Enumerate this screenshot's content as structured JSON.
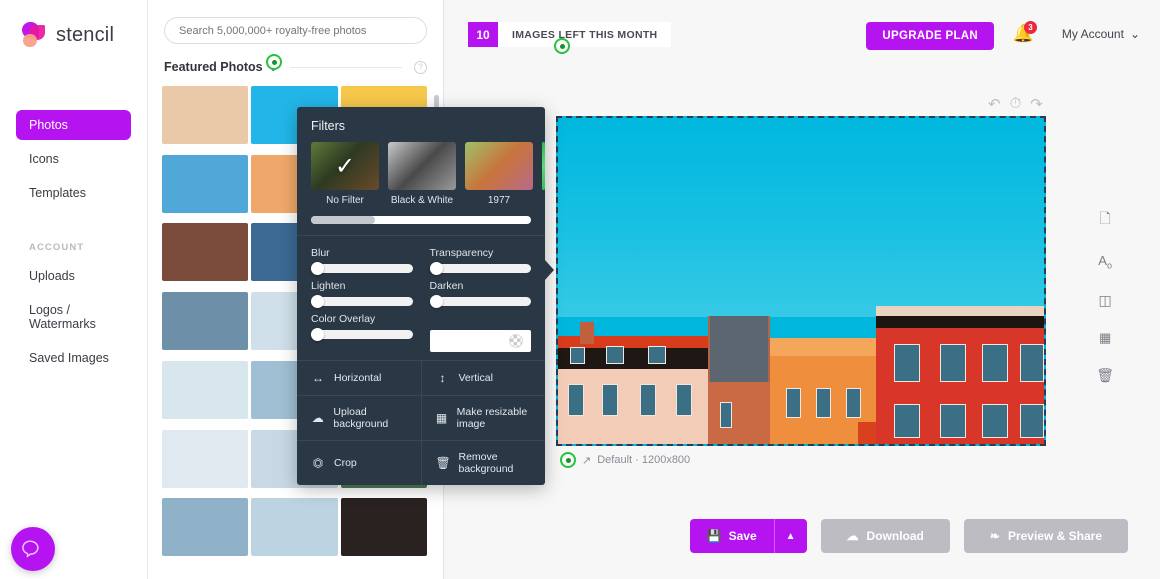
{
  "brand": {
    "name": "stencil",
    "logo_icon": "stencil-logo-icon"
  },
  "sidebar": {
    "items": [
      {
        "label": "Photos",
        "active": true
      },
      {
        "label": "Icons",
        "active": false
      },
      {
        "label": "Templates",
        "active": false
      }
    ],
    "section_label": "ACCOUNT",
    "account_items": [
      {
        "label": "Uploads"
      },
      {
        "label": "Logos / Watermarks"
      },
      {
        "label": "Saved Images"
      }
    ]
  },
  "search": {
    "placeholder": "Search 5,000,000+ royalty-free photos",
    "value": ""
  },
  "photo_panel": {
    "featured_title": "Featured Photos",
    "chevron_icon": "chevron-down-icon",
    "help_icon": "question-mark-icon",
    "help_label": "?",
    "thumbs": [
      "#e9c9a8",
      "#22b6e8",
      "#f6c84a",
      "#4fa8d8",
      "#f0a86a",
      "#2f6f9a",
      "#7a4a3a",
      "#3c6a94",
      "#c9d6e2",
      "#6d8fa8",
      "#cfe0ea",
      "#b4cfe0",
      "#d8e6ee",
      "#9fc0d4",
      "#e8eef2",
      "#dfe9ef",
      "#c8d8e4",
      "#4f7a56",
      "#8fb2c8",
      "#bcd4e2",
      "#2a2220"
    ]
  },
  "header": {
    "quota_number": "10",
    "quota_text": "IMAGES LEFT THIS MONTH",
    "upgrade_label": "UPGRADE PLAN",
    "bell_icon": "bell-icon",
    "bell_badge": "3",
    "account_label": "My Account",
    "account_caret_icon": "chevron-down-icon"
  },
  "canvas": {
    "undo_icon": "undo-icon",
    "history_icon": "history-clock-icon",
    "redo_icon": "redo-icon",
    "label": "Default · 1200x800",
    "resize_icon": "resize-arrow-icon",
    "tools": [
      {
        "icon": "page-icon",
        "name": "page-tool"
      },
      {
        "icon": "text-icon",
        "name": "text-tool"
      },
      {
        "icon": "rectangle-icon",
        "name": "shape-tool"
      },
      {
        "icon": "grid-icon",
        "name": "grid-tool"
      },
      {
        "icon": "trash-icon",
        "name": "delete-tool"
      }
    ]
  },
  "filters": {
    "title": "Filters",
    "presets": [
      {
        "label": "No Filter",
        "selected": true
      },
      {
        "label": "Black & White",
        "selected": false
      },
      {
        "label": "1977",
        "selected": false
      }
    ],
    "check_icon": "checkmark-icon",
    "sliders": [
      {
        "label": "Blur",
        "value": 0
      },
      {
        "label": "Transparency",
        "value": 0
      },
      {
        "label": "Lighten",
        "value": 0
      },
      {
        "label": "Darken",
        "value": 0
      },
      {
        "label": "Color Overlay",
        "value": 0
      }
    ],
    "color_swatch": {
      "name": "color-overlay-swatch",
      "value": ""
    },
    "actions": [
      {
        "label": "Horizontal",
        "icon": "flip-horizontal-icon",
        "glyph": "↔"
      },
      {
        "label": "Vertical",
        "icon": "flip-vertical-icon",
        "glyph": "↕"
      },
      {
        "label": "Upload background",
        "icon": "cloud-upload-icon",
        "glyph": "☁"
      },
      {
        "label": "Make resizable image",
        "icon": "image-icon",
        "glyph": "🖼"
      },
      {
        "label": "Crop",
        "icon": "crop-icon",
        "glyph": "⛶"
      },
      {
        "label": "Remove background",
        "icon": "trash-icon",
        "glyph": "🗑"
      }
    ]
  },
  "actions_bar": {
    "save_label": "Save",
    "save_icon": "floppy-disk-icon",
    "save_caret_icon": "chevron-up-icon",
    "download_label": "Download",
    "download_icon": "cloud-download-icon",
    "preview_label": "Preview & Share",
    "preview_icon": "share-icon"
  },
  "help_widget": {
    "icon": "chat-bubble-icon",
    "name": "help-widget"
  },
  "colors": {
    "accent": "#b514f0",
    "panel_dark": "#2a3744",
    "cursor_green": "#27c23f",
    "badge_red": "#e8293f"
  }
}
